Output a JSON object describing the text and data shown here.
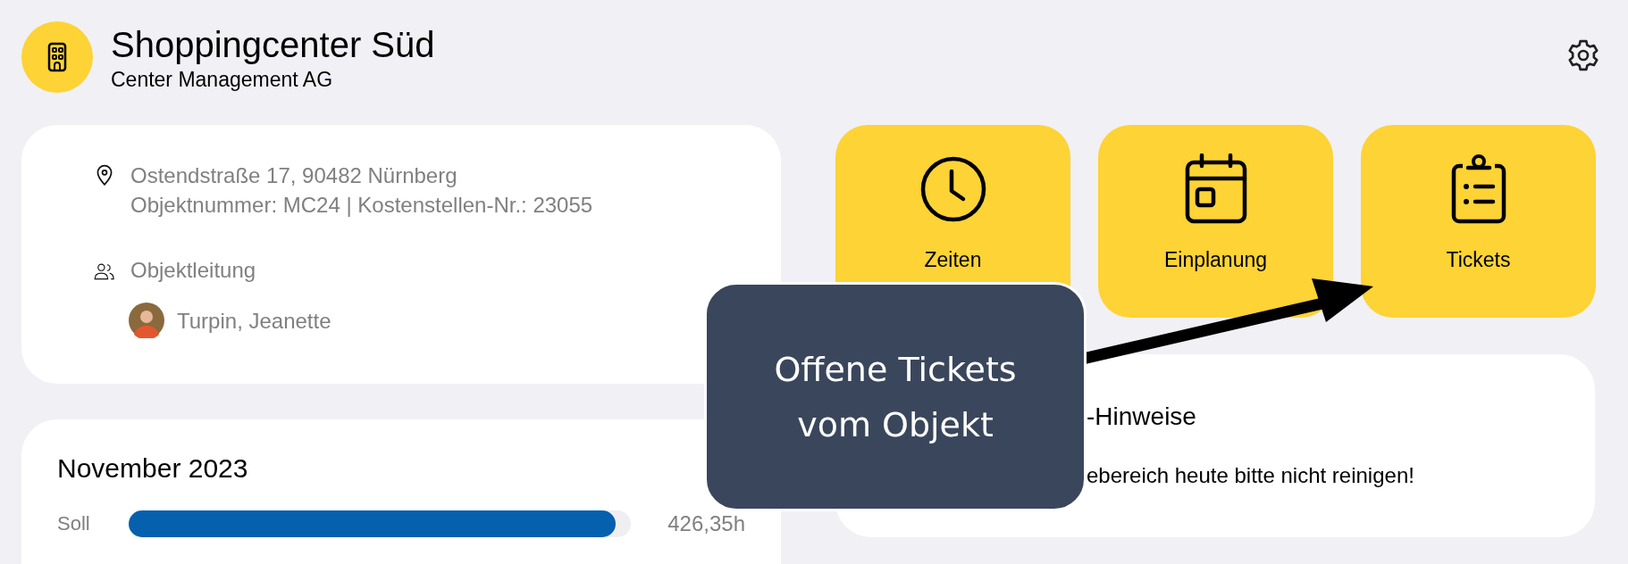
{
  "header": {
    "title": "Shoppingcenter Süd",
    "subtitle": "Center Management AG"
  },
  "object_card": {
    "address": "Ostendstraße 17, 90482 Nürnberg",
    "details": "Objektnummer: MC24 | Kostenstellen-Nr.: 23055",
    "manager_label": "Objektleitung",
    "manager_name": "Turpin, Jeanette"
  },
  "tiles": [
    {
      "label": "Zeiten",
      "kind": "clock"
    },
    {
      "label": "Einplanung",
      "kind": "calendar"
    },
    {
      "label": "Tickets",
      "kind": "clipboard"
    }
  ],
  "notice": {
    "title": "-Hinweise",
    "text": "ebereich heute bitte nicht reinigen!"
  },
  "tooltip": {
    "text": "Offene Tickets vom Objekt"
  },
  "month_card": {
    "title": "November 2023",
    "bars": [
      {
        "label": "Soll",
        "level": 0.97,
        "reading": "426,35h"
      }
    ]
  }
}
